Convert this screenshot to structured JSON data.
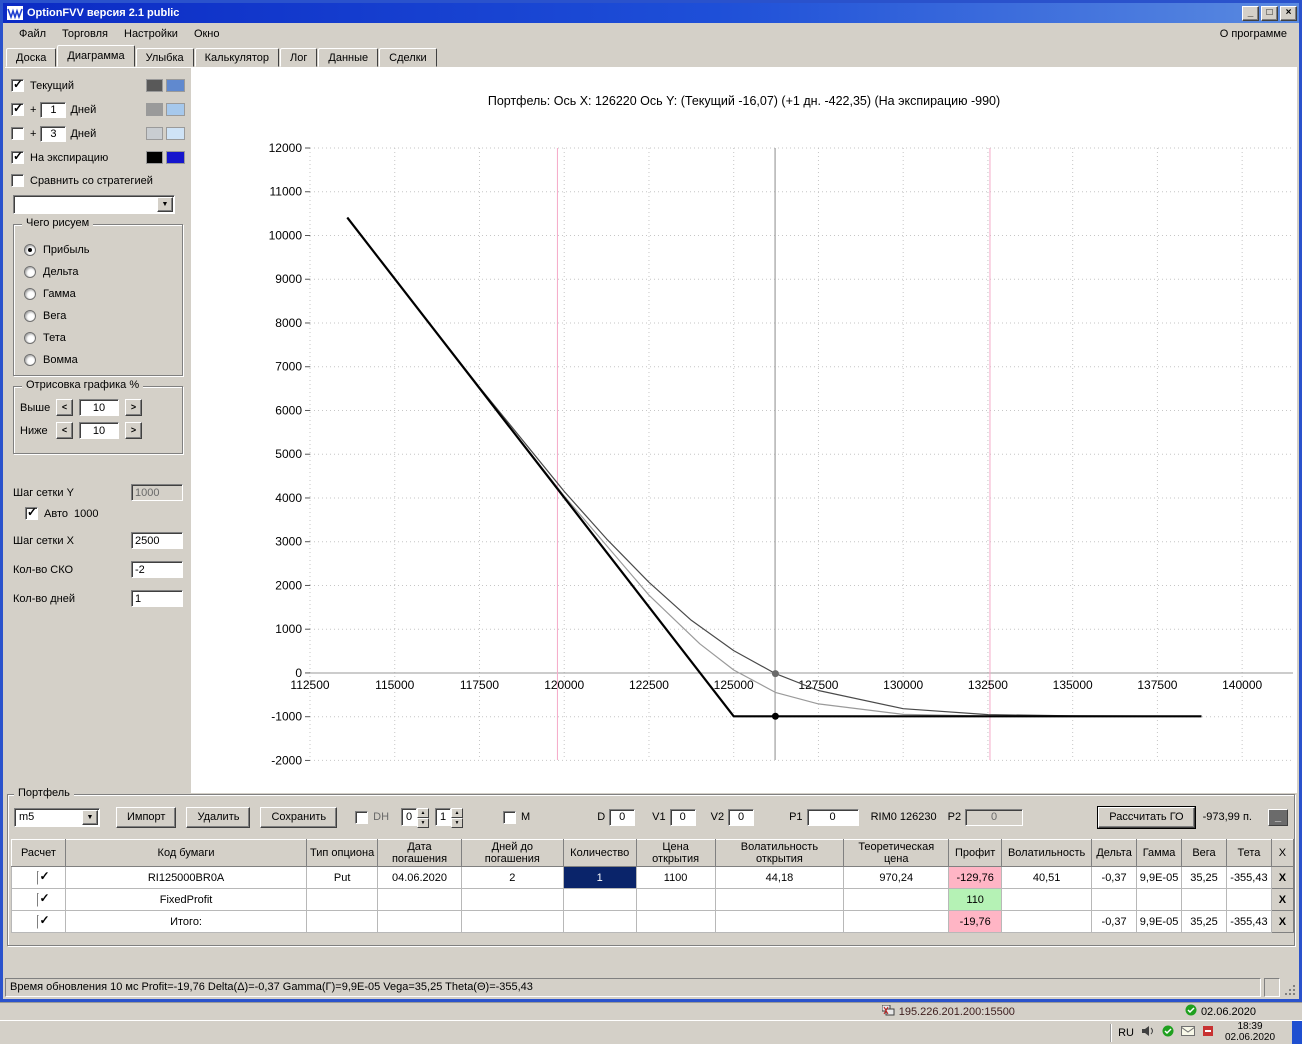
{
  "window": {
    "title": "OptionFVV версия 2.1 public",
    "controls": {
      "minimize": "_",
      "maximize": "□",
      "close": "×"
    }
  },
  "menu": {
    "items": [
      {
        "key": "file",
        "label": "Файл"
      },
      {
        "key": "trading",
        "label": "Торговля"
      },
      {
        "key": "settings",
        "label": "Настройки"
      },
      {
        "key": "window",
        "label": "Окно"
      }
    ],
    "right": "О программе"
  },
  "tabs": {
    "active": "Диаграмма",
    "items": [
      {
        "key": "board",
        "label": "Доска"
      },
      {
        "key": "diagram",
        "label": "Диаграмма"
      },
      {
        "key": "smile",
        "label": "Улыбка"
      },
      {
        "key": "calculator",
        "label": "Калькулятор"
      },
      {
        "key": "log",
        "label": "Лог"
      },
      {
        "key": "data",
        "label": "Данные"
      },
      {
        "key": "deals",
        "label": "Сделки"
      }
    ]
  },
  "sidebar": {
    "legend": [
      {
        "key": "current",
        "label": "Текущий",
        "checked": true,
        "colors": [
          "#595959",
          "#6089cf"
        ]
      },
      {
        "key": "plus1",
        "prefix": "+",
        "value": "1",
        "label": "Дней",
        "checked": true,
        "colors": [
          "#9a9a9a",
          "#a6c8ec"
        ]
      },
      {
        "key": "plus3",
        "prefix": "+",
        "value": "3",
        "label": "Дней",
        "checked": false,
        "colors": [
          "#c9cdd1",
          "#cfe3f6"
        ]
      },
      {
        "key": "expiration",
        "label": "На экспирацию",
        "checked": true,
        "colors": [
          "#000000",
          "#1515cd"
        ]
      }
    ],
    "compare": {
      "label": "Сравнить со стратегией",
      "checked": false,
      "selected_value": ""
    },
    "draw_group": {
      "title": "Чего рисуем",
      "selected": "Прибыль",
      "options": [
        {
          "key": "profit",
          "label": "Прибыль"
        },
        {
          "key": "delta",
          "label": "Дельта"
        },
        {
          "key": "gamma",
          "label": "Гамма"
        },
        {
          "key": "vega",
          "label": "Вега"
        },
        {
          "key": "theta",
          "label": "Тета"
        },
        {
          "key": "vomma",
          "label": "Вомма"
        }
      ]
    },
    "render_group": {
      "title": "Отрисовка графика %",
      "rows": [
        {
          "key": "above",
          "label": "Выше",
          "value": "10"
        },
        {
          "key": "below",
          "label": "Ниже",
          "value": "10"
        }
      ]
    },
    "fields": {
      "grid_y_label": "Шаг сетки Y",
      "grid_y_value": "1000",
      "auto_label": "Авто",
      "auto_checked": true,
      "auto_value": "1000",
      "grid_x_label": "Шаг сетки X",
      "grid_x_value": "2500",
      "sko_label": "Кол-во СКО",
      "sko_value": "-2",
      "days_label": "Кол-во дней",
      "days_value": "1"
    }
  },
  "chart": {
    "title": "Портфель: Ось X: 126220 Ось Y:  (Текущий -16,07)  (+1 дн. -422,35)  (На экспирацию -990)"
  },
  "chart_data": {
    "type": "line",
    "title": "Портфель: Ось X: 126220 Ось Y: (Текущий -16,07) (+1 дн. -422,35) (На экспирацию -990)",
    "xlabel": "",
    "ylabel": "",
    "grid": true,
    "legend_position": "none",
    "xlim": [
      112500,
      141500
    ],
    "ylim": [
      -1990,
      12000
    ],
    "x_ticks": [
      112500,
      115000,
      117500,
      120000,
      122500,
      125000,
      127500,
      130000,
      132500,
      135000,
      137500,
      140000
    ],
    "y_ticks": [
      -2000,
      -1000,
      0,
      1000,
      2000,
      3000,
      4000,
      5000,
      6000,
      7000,
      8000,
      9000,
      10000,
      11000,
      12000
    ],
    "vlines": [
      {
        "name": "sko-lower",
        "x": 119800,
        "color": "#f5a9c8"
      },
      {
        "name": "sko-upper",
        "x": 132560,
        "color": "#f5a9c8"
      },
      {
        "name": "crosshair",
        "x": 126220,
        "color": "#8c8c8c"
      }
    ],
    "series": [
      {
        "key": "plus1",
        "name": "+1 дн.",
        "color": "#9a9a9a",
        "width": 1.2,
        "points": [
          [
            113600,
            10410
          ],
          [
            115000,
            9010
          ],
          [
            117500,
            6510
          ],
          [
            120000,
            4046
          ],
          [
            122500,
            1778
          ],
          [
            124000,
            667
          ],
          [
            125000,
            67
          ],
          [
            126230,
            -444
          ],
          [
            127500,
            -708
          ],
          [
            130000,
            -947
          ],
          [
            132500,
            -987
          ],
          [
            135000,
            -990
          ],
          [
            138800,
            -990
          ]
        ]
      },
      {
        "key": "current",
        "name": "Текущий",
        "color": "#4a4a4a",
        "width": 1.2,
        "points": [
          [
            113600,
            10411
          ],
          [
            115000,
            9013
          ],
          [
            117500,
            6533
          ],
          [
            120000,
            4151
          ],
          [
            121250,
            3065
          ],
          [
            122500,
            2072
          ],
          [
            123750,
            1204
          ],
          [
            125000,
            510
          ],
          [
            126230,
            -15
          ],
          [
            127500,
            -402
          ],
          [
            130000,
            -818
          ],
          [
            132500,
            -953
          ],
          [
            135000,
            -983
          ],
          [
            138800,
            -989
          ]
        ]
      },
      {
        "key": "expiration",
        "name": "На экспирацию",
        "color": "#000000",
        "width": 2.2,
        "points": [
          [
            113600,
            10410
          ],
          [
            125000,
            -990
          ],
          [
            138800,
            -990
          ]
        ]
      }
    ],
    "markers": [
      {
        "name": "current-point-marker",
        "x": 126230,
        "y": -15,
        "color": "#6a6a6a"
      },
      {
        "name": "expiration-point-marker",
        "x": 126230,
        "y": -990,
        "color": "#000000"
      }
    ]
  },
  "portfolio": {
    "group_label": "Портфель",
    "preset": "m5",
    "import_button": "Импорт",
    "delete_button": "Удалить",
    "save_button": "Сохранить",
    "dh_label": "DH",
    "dh_spin1": "0",
    "dh_spin2": "1",
    "m_label": "М",
    "d_label": "D",
    "d_value": "0",
    "v1_label": "V1",
    "v1_value": "0",
    "v2_label": "V2",
    "v2_value": "0",
    "p1_label": "P1",
    "p1_value": "0",
    "rim_label": "RIM0 126230",
    "p2_label": "P2",
    "p2_value": "0",
    "calc_go_button": "Рассчитать ГО",
    "go_value": "-973,99 п.",
    "minimize_button": "_",
    "table": {
      "delete_label": "X",
      "headers": [
        "Расчет",
        "Код бумаги",
        "Тип опциона",
        "Дата погашения",
        "Дней до погашения",
        "Количество",
        "Цена открытия",
        "Волатильность открытия",
        "Теоретическая цена",
        "Профит",
        "Волатильность",
        "Дельта",
        "Гамма",
        "Вега",
        "Тета",
        "X"
      ],
      "rows": [
        {
          "checked": true,
          "qty_selected": true,
          "profit_bg": "#ffb5c5",
          "cells": {
            "code": "RI125000BR0A",
            "type": "Put",
            "expiry": "04.06.2020",
            "days": "2",
            "qty": "1",
            "open_price": "1100",
            "open_vol": "44,18",
            "theor": "970,24",
            "profit": "-129,76",
            "vol": "40,51",
            "delta": "-0,37",
            "gamma": "9,9E-05",
            "vega": "35,25",
            "theta": "-355,43"
          }
        },
        {
          "checked": true,
          "profit_bg": "#b5f2b5",
          "cells": {
            "code": "FixedProfit",
            "profit": "110"
          }
        },
        {
          "checked": true,
          "profit_bg": "#ffb5c5",
          "cells": {
            "code": "Итого:",
            "profit": "-19,76",
            "delta": "-0,37",
            "gamma": "9,9E-05",
            "vega": "35,25",
            "theta": "-355,43"
          }
        }
      ]
    }
  },
  "statusbar": {
    "text": "Время обновления 10 мс  Profit=-19,76 Delta(Δ)=-0,37 Gamma(Γ)=9,9E-05 Vega=35,25 Theta(Θ)=-355,43"
  },
  "system_tray": {
    "connection": "195.226.201.200:15500",
    "connection_date": "02.06.2020",
    "language": "RU",
    "time": "18:39",
    "date": "02.06.2020"
  }
}
